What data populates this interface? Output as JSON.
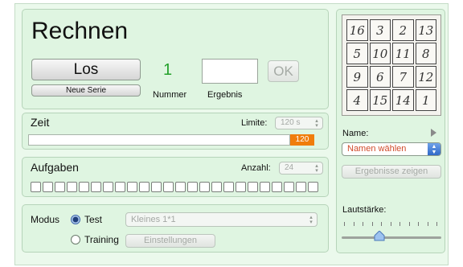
{
  "main": {
    "title": "Rechnen",
    "go_button": "Los",
    "new_series_button": "Neue Serie",
    "number_value": "1",
    "number_label": "Nummer",
    "result_label": "Ergebnis",
    "result_value": "",
    "ok_button": "OK"
  },
  "time": {
    "title": "Zeit",
    "limit_label": "Limite:",
    "limit_value": "120 s",
    "bar_value": "120",
    "progress": 1.0
  },
  "tasks": {
    "title": "Aufgaben",
    "count_label": "Anzahl:",
    "count_value": "24",
    "boxes": 24
  },
  "mode": {
    "label": "Modus",
    "test_label": "Test",
    "training_label": "Training",
    "selected": "Test",
    "exercise_select": "Kleines 1*1",
    "settings_button": "Einstellungen"
  },
  "side": {
    "magic_square": [
      "16",
      "3",
      "2",
      "13",
      "5",
      "10",
      "11",
      "8",
      "9",
      "6",
      "7",
      "12",
      "4",
      "15",
      "14",
      "1"
    ],
    "name_label": "Name:",
    "name_select": "Namen wählen",
    "results_button": "Ergebnisse zeigen",
    "volume_label": "Lautstärke:",
    "volume_level": 0.38
  },
  "colors": {
    "accent_green": "#23a12a",
    "time_orange": "#f07d0b",
    "name_red": "#d04a2a"
  },
  "icons": {
    "play": "play-triangle-icon"
  }
}
